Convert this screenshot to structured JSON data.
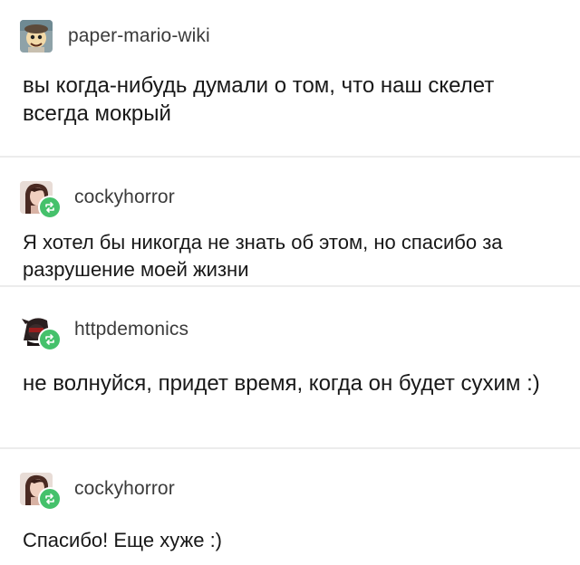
{
  "posts": [
    {
      "username": "paper-mario-wiki",
      "text": "вы когда-нибудь думали о том, что наш скелет всегда мокрый",
      "avatar_icon": "paper-mario-avatar",
      "reblog": false
    },
    {
      "username": "cockyhorror",
      "text": "Я хотел бы никогда не знать об этом, но спасибо за разрушение моей жизни",
      "avatar_icon": "user-avatar",
      "reblog": true
    },
    {
      "username": "httpdemonics",
      "text": "не волнуйся, придет время, когда он будет сухим :)",
      "avatar_icon": "user-avatar",
      "reblog": true
    },
    {
      "username": "cockyhorror",
      "text": "Спасибо! Еще хуже :)",
      "avatar_icon": "user-avatar",
      "reblog": true
    }
  ],
  "colors": {
    "reblog_badge": "#45c16b",
    "divider": "#ececec"
  }
}
